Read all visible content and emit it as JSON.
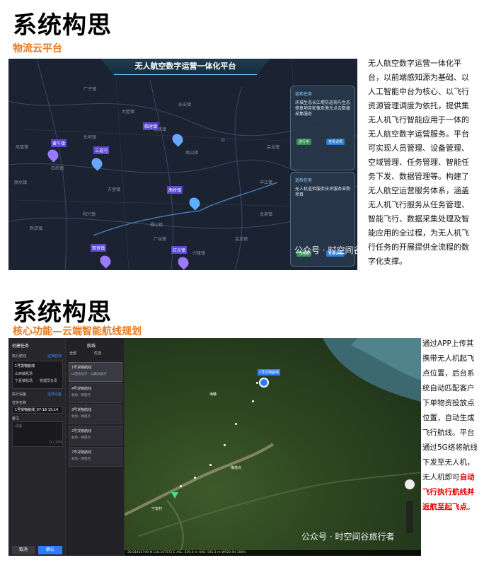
{
  "section1": {
    "title": "系统构思",
    "subtitle": "物流云平台",
    "panel_header": "无人航空数字运营一体化平台",
    "description": "无人航空数字运营一体化平台，以前端感知源为基础、以人工智能中台为核心、以飞行资源管理调度为依托，提供集无人机飞行智能应用于一体的无人航空数字运营服务。平台可实现人员管理、设备管理、空域管理、任务管理、智能任务下发、数据管理等。构建了无人航空运营服务体系，涵盖无人机飞行服务从任务管理、智能飞行、数据采集处理及智能应用的全过程，为无人机飞行任务的开展提供全流程的数字化支撑。",
    "watermark": "公众号 · 时空间谷旅行者",
    "map_labels": [
      "广子镇",
      "大胜镇",
      "长坝镇",
      "南山镇",
      "石岭镇",
      "中江镇",
      "丽水镇",
      "沁",
      "万里镇",
      "双凤镇",
      "新店镇",
      "和兴镇",
      "福山镇",
      "广坛镇",
      "兴隆镇",
      "金龙镇",
      "凤凰镇",
      "龙泉镇",
      "会龙镇",
      "永安镇"
    ],
    "pins": [
      {
        "label": "黄牛镇"
      },
      {
        "label": "三道河"
      },
      {
        "label": "临时镇"
      },
      {
        "label": "高桥镇"
      },
      {
        "label": "观音镇"
      },
      {
        "label": "红光镇"
      }
    ],
    "cards": [
      {
        "title": "巡检任务",
        "text": "环城生态长江堤防巡视与生态修复项目影像及激光点云数据采集服务",
        "status": "进行中",
        "btn": "查看详情"
      },
      {
        "title": "巡检任务",
        "text": "无人机巡检服务技术服务采购项目",
        "status": "已完成",
        "btn": "查看详情"
      }
    ]
  },
  "section2": {
    "title": "系统构思",
    "subtitle": "核心功能—云端智能航线规划",
    "description_plain": "通过APP上传其携带无人机起飞点位置，后台系统自动匹配客户下单物资投放点位置，自动生成飞行航线。平台通过5G络将航线下发至无人机，无人机即可",
    "description_red": "自动飞行执行航线并返航至起飞点",
    "description_end": "。",
    "watermark": "公众号 · 时空间谷旅行者",
    "left_panel": {
      "header": "创建任务",
      "route_label": "执行航线",
      "route_link": "选择航线",
      "items": [
        "1号货物航线",
        "山西镇机场",
        "宁夏镇机场",
        "管理员负责"
      ],
      "device_label": "执行设备",
      "device_link": "选择设备",
      "task_name_label": "任务名称",
      "task_name_value": "1号货物航线_07-18 15:14",
      "note_label": "备注",
      "note_placeholder": "请输",
      "note_count": "0 / 200",
      "cancel": "取消",
      "confirm": "确认"
    },
    "mid_panel": {
      "header": "航线",
      "filter1": "全部",
      "filter2": "优选",
      "routes": [
        {
          "name": "1号货物航线",
          "sub": "山西机场点 - 公路派送点"
        },
        {
          "name": "4号货物航线",
          "sub": "机场 - 降落点"
        },
        {
          "name": "3号货物航线",
          "sub": "机场 - 降落点"
        },
        {
          "name": "2号货物航线",
          "sub": "机场 - 降落点"
        },
        {
          "name": "7号货物航线",
          "sub": "机场 - 降落点"
        }
      ]
    },
    "map": {
      "start_label": "1号货物航线",
      "end_label": "宁安村",
      "place1": "海曦",
      "place2": "降落点",
      "status_bar": "28.81445749 N  118.167572 E   ASL: 539.4 m   HAE: 541.1 m   W920.94   100%"
    }
  }
}
